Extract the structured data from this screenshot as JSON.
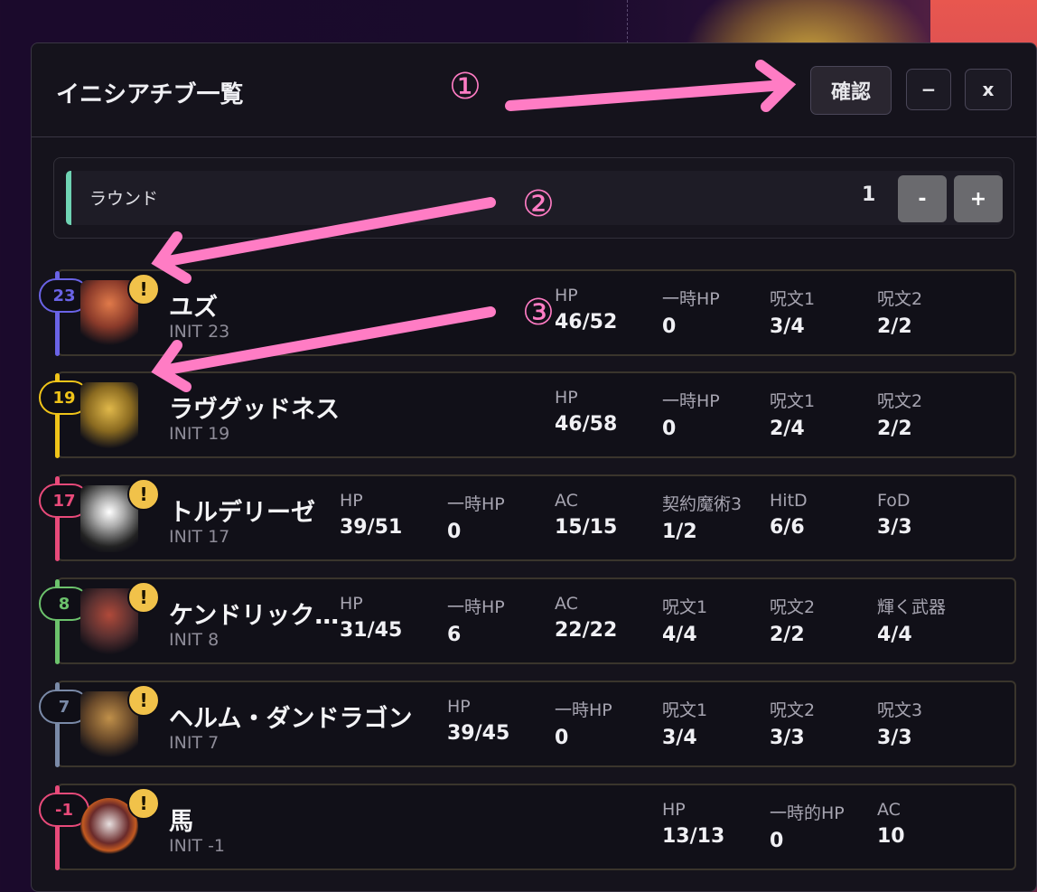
{
  "window": {
    "title": "イニシアチブ一覧",
    "confirm_label": "確認",
    "minimize_label": "−",
    "close_label": "x"
  },
  "round": {
    "label": "ラウンド",
    "value": "1",
    "minus_label": "-",
    "plus_label": "+",
    "accent_color": "#6fd3b3"
  },
  "annotations": {
    "one": "①",
    "two": "②",
    "three": "③",
    "color": "#ff7cc4"
  },
  "warn_symbol": "!",
  "combatants": [
    {
      "init_badge": "23",
      "name": "ユズ",
      "init_text": "INIT 23",
      "color": "#6a63e6",
      "warning": true,
      "stats": [
        {
          "label": "HP",
          "value": "46/52"
        },
        {
          "label": "一時HP",
          "value": "0"
        },
        {
          "label": "呪文1",
          "value": "3/4"
        },
        {
          "label": "呪文2",
          "value": "2/2"
        }
      ]
    },
    {
      "init_badge": "19",
      "name": "ラヴグッドネス",
      "init_text": "INIT 19",
      "color": "#f0c419",
      "warning": false,
      "stats": [
        {
          "label": "HP",
          "value": "46/58"
        },
        {
          "label": "一時HP",
          "value": "0"
        },
        {
          "label": "呪文1",
          "value": "2/4"
        },
        {
          "label": "呪文2",
          "value": "2/2"
        }
      ]
    },
    {
      "init_badge": "17",
      "name": "トルデリーゼ",
      "init_text": "INIT 17",
      "color": "#e84a7a",
      "warning": true,
      "stats": [
        {
          "label": "HP",
          "value": "39/51"
        },
        {
          "label": "一時HP",
          "value": "0"
        },
        {
          "label": "AC",
          "value": "15/15"
        },
        {
          "label": "契約魔術3",
          "value": "1/2"
        },
        {
          "label": "HitD",
          "value": "6/6"
        },
        {
          "label": "FoD",
          "value": "3/3"
        }
      ]
    },
    {
      "init_badge": "8",
      "name": "ケンドリック…",
      "init_text": "INIT 8",
      "color": "#6cc26c",
      "warning": true,
      "stats": [
        {
          "label": "HP",
          "value": "31/45"
        },
        {
          "label": "一時HP",
          "value": "6"
        },
        {
          "label": "AC",
          "value": "22/22"
        },
        {
          "label": "呪文1",
          "value": "4/4"
        },
        {
          "label": "呪文2",
          "value": "2/2"
        },
        {
          "label": "輝く武器",
          "value": "4/4"
        }
      ]
    },
    {
      "init_badge": "7",
      "name": "ヘルム・ダンドラゴン",
      "init_text": "INIT 7",
      "color": "#7a8aa8",
      "warning": true,
      "stats": [
        {
          "label": "HP",
          "value": "39/45"
        },
        {
          "label": "一時HP",
          "value": "0"
        },
        {
          "label": "呪文1",
          "value": "3/4"
        },
        {
          "label": "呪文2",
          "value": "3/3"
        },
        {
          "label": "呪文3",
          "value": "3/3"
        }
      ]
    },
    {
      "init_badge": "-1",
      "name": "馬",
      "init_text": "INIT -1",
      "color": "#e84a7a",
      "warning": true,
      "stats": [
        {
          "label": "HP",
          "value": "13/13"
        },
        {
          "label": "一時的HP",
          "value": "0"
        },
        {
          "label": "AC",
          "value": "10"
        }
      ]
    }
  ]
}
